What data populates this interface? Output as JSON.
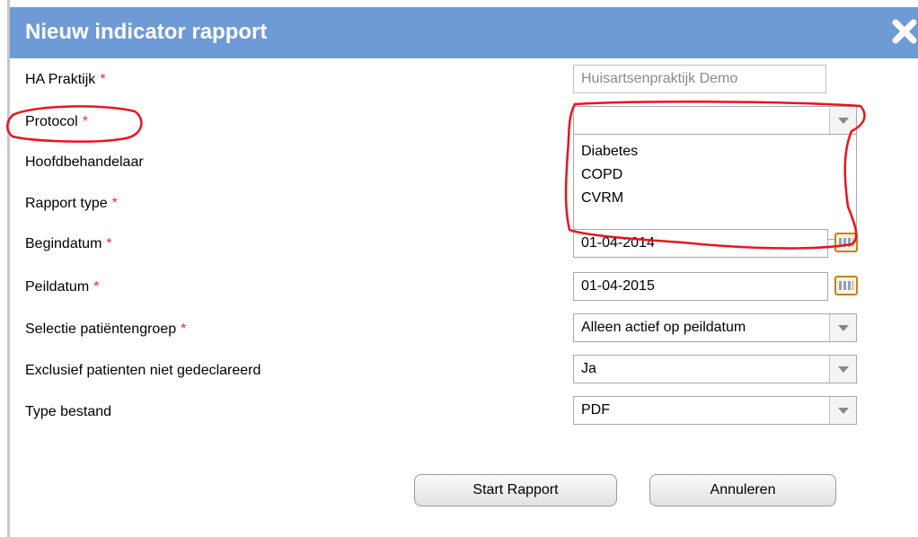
{
  "dialog": {
    "title": "Nieuw indicator rapport",
    "close_icon": "close-icon"
  },
  "fields": {
    "ha_praktijk": {
      "label": "HA Praktijk",
      "required": "*",
      "value": "Huisartsenpraktijk Demo"
    },
    "protocol": {
      "label": "Protocol",
      "required": "*",
      "value": ""
    },
    "hoofdbehandelaar": {
      "label": "Hoofdbehandelaar"
    },
    "rapport_type": {
      "label": "Rapport type",
      "required": "*"
    },
    "begindatum": {
      "label": "Begindatum",
      "required": "*",
      "value": "01-04-2014"
    },
    "peildatum": {
      "label": "Peildatum",
      "required": "*",
      "value": "01-04-2015"
    },
    "selectie": {
      "label": "Selectie patiëntengroep",
      "required": "*",
      "value": "Alleen actief op peildatum"
    },
    "exclusief": {
      "label": "Exclusief patienten niet gedeclareerd",
      "value": "Ja"
    },
    "type_bestand": {
      "label": "Type bestand",
      "value": "PDF"
    }
  },
  "protocol_options": [
    "Diabetes",
    "COPD",
    "CVRM"
  ],
  "buttons": {
    "start": "Start Rapport",
    "cancel": "Annuleren"
  },
  "colors": {
    "titlebar": "#6e9bd6",
    "required": "#e03030",
    "annotation": "#e8141e"
  },
  "icons": {
    "calendar": "calendar-icon",
    "dropdown_arrow": "chevron-down-icon"
  }
}
